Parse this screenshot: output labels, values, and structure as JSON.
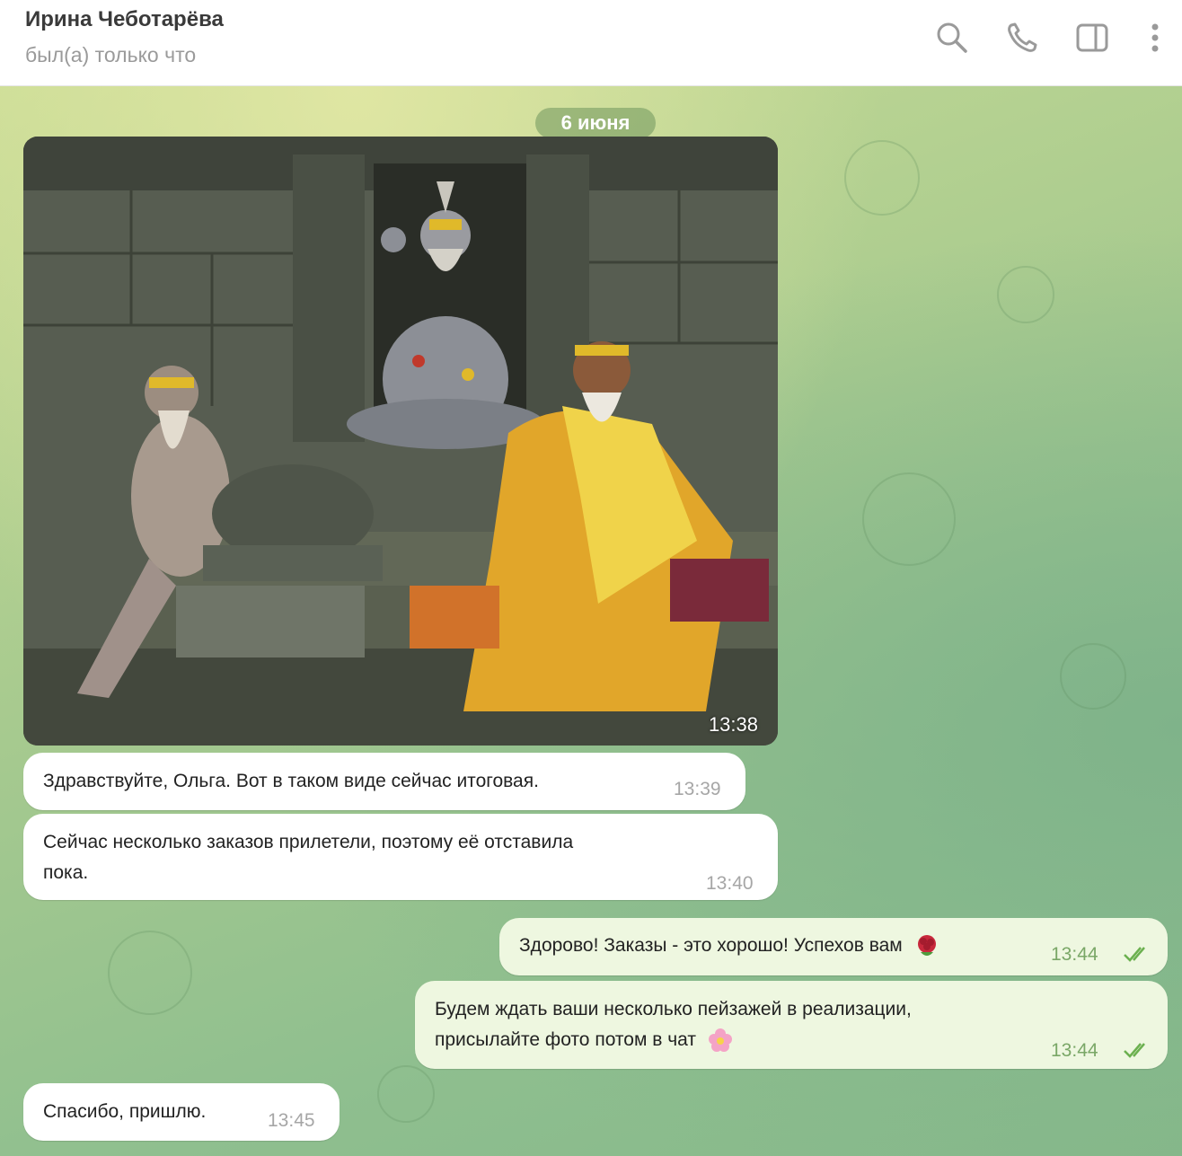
{
  "header": {
    "contact_name": "Ирина Чеботарёва",
    "status": "был(а) только что",
    "icons": [
      "search-icon",
      "phone-icon",
      "sidebar-panel-icon",
      "more-vertical-icon"
    ]
  },
  "chat": {
    "date_label": "6 июня",
    "photo_time": "13:38",
    "messages": [
      {
        "direction": "in",
        "text": "Здравствуйте, Ольга. Вот в таком виде сейчас итоговая.",
        "time": "13:39"
      },
      {
        "direction": "in",
        "text_line1": "Сейчас несколько заказов прилетели, поэтому её отставила",
        "text_line2": "пока.",
        "time": "13:40"
      },
      {
        "direction": "out",
        "text": "Здорово! Заказы - это хорошо! Успехов вам",
        "emoji": "rose-emoji",
        "time": "13:44",
        "read": true
      },
      {
        "direction": "out",
        "text_line1": "Будем ждать ваши несколько пейзажей в реализации,",
        "text_line2": "присылайте фото потом в чат",
        "emoji": "blossom-emoji",
        "time": "13:44",
        "read": true
      },
      {
        "direction": "in",
        "text": "Спасибо, пришлю.",
        "time": "13:45"
      }
    ]
  },
  "colors": {
    "incoming_bubble": "#ffffff",
    "outgoing_bubble": "#eef7e0",
    "read_check": "#6bb04f",
    "date_pill": "#7a9a5c"
  }
}
